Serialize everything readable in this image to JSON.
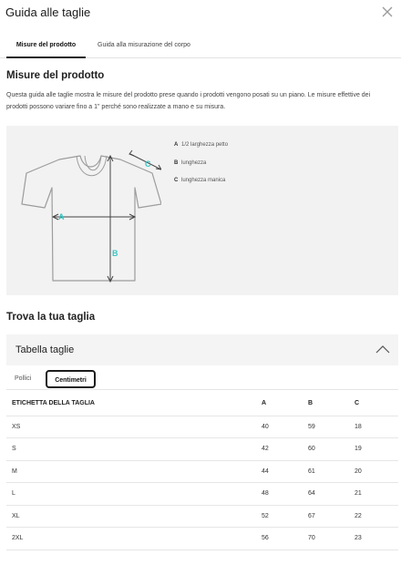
{
  "header": {
    "title": "Guida alle taglie"
  },
  "tabs": [
    {
      "label": "Misure del prodotto",
      "active": true
    },
    {
      "label": "Guida alla misurazione del corpo",
      "active": false
    }
  ],
  "product": {
    "heading": "Misure del prodotto",
    "description": "Questa guida alle taglie mostra le misure del prodotto prese quando i prodotti vengono posati su un piano. Le misure effettive dei prodotti possono variare fino a 1\" perché sono realizzate a mano e su misura."
  },
  "diagram": {
    "markers": {
      "a": "A",
      "b": "B",
      "c": "C"
    },
    "legend": [
      {
        "key": "A",
        "label": "1/2 larghezza petto"
      },
      {
        "key": "B",
        "label": "lunghezza"
      },
      {
        "key": "C",
        "label": "lunghezza manica"
      }
    ],
    "accent_color": "#3cc4c4"
  },
  "find": {
    "heading": "Trova la tua taglia"
  },
  "accordion": {
    "title": "Tabella taglie",
    "icon": "chevron-up-icon"
  },
  "units": [
    {
      "label": "Pollici",
      "active": false
    },
    {
      "label": "Centimetri",
      "active": true
    }
  ],
  "table": {
    "headers": [
      "ETICHETTA DELLA TAGLIA",
      "A",
      "B",
      "C"
    ],
    "rows": [
      [
        "XS",
        "40",
        "59",
        "18"
      ],
      [
        "S",
        "42",
        "60",
        "19"
      ],
      [
        "M",
        "44",
        "61",
        "20"
      ],
      [
        "L",
        "48",
        "64",
        "21"
      ],
      [
        "XL",
        "52",
        "67",
        "22"
      ],
      [
        "2XL",
        "56",
        "70",
        "23"
      ]
    ]
  }
}
